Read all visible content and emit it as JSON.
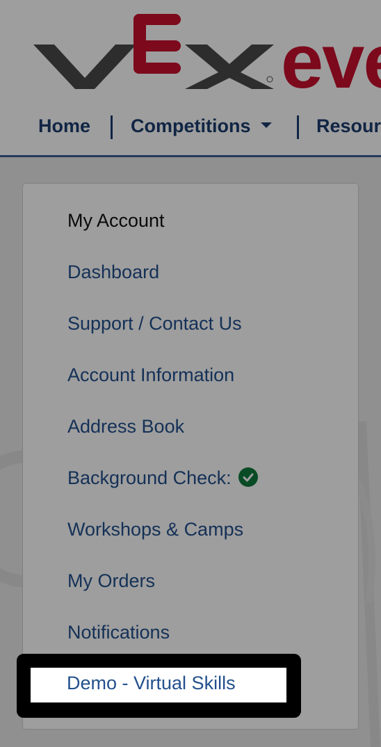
{
  "brand": {
    "logo_text": "eve",
    "accent_color": "#c8102e",
    "dark_logo_color": "#4a4a4a",
    "nav_color": "#1c3d6e",
    "link_color": "#23508d"
  },
  "nav": {
    "home": "Home",
    "competitions": "Competitions",
    "resources": "Resour"
  },
  "account_menu": {
    "heading": "My Account",
    "items": [
      {
        "label": "Dashboard"
      },
      {
        "label": "Support / Contact Us"
      },
      {
        "label": "Account Information"
      },
      {
        "label": "Address Book"
      },
      {
        "label": "Background Check:",
        "icon": "check-circle-icon",
        "status_color": "#0f7a3c"
      },
      {
        "label": "Workshops & Camps"
      },
      {
        "label": "My Orders"
      },
      {
        "label": "Notifications"
      },
      {
        "label": "Demo - Virtual Skills",
        "highlighted": true
      }
    ]
  }
}
